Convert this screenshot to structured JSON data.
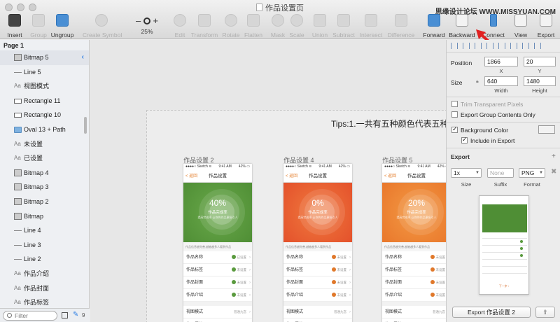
{
  "window": {
    "title": "作品设置页",
    "watermark": "思缘设计论坛 WWW.MISSYUAN.COM"
  },
  "toolbar": {
    "insert": "Insert",
    "group": "Group",
    "ungroup": "Ungroup",
    "create_symbol": "Create Symbol",
    "zoom_minus": "–",
    "zoom_plus": "+",
    "zoom_level": "25%",
    "edit": "Edit",
    "transform": "Transform",
    "rotate": "Rotate",
    "flatten": "Flatten",
    "mask": "Mask",
    "scale": "Scale",
    "union": "Union",
    "subtract": "Subtract",
    "intersect": "Intersect",
    "difference": "Difference",
    "forward": "Forward",
    "backward": "Backward",
    "connect": "Connect",
    "view": "View",
    "export": "Export"
  },
  "sidebar": {
    "page_label": "Page 1",
    "layers": [
      {
        "name": "Bitmap 5",
        "kind": "bitmap",
        "selected": true
      },
      {
        "name": "Line 5",
        "kind": "line"
      },
      {
        "name": "视图模式",
        "kind": "text"
      },
      {
        "name": "Rectangle 11",
        "kind": "rect"
      },
      {
        "name": "Rectangle 10",
        "kind": "rect"
      },
      {
        "name": "Oval 13 + Path",
        "kind": "folder"
      },
      {
        "name": "未设置",
        "kind": "text"
      },
      {
        "name": "已设置",
        "kind": "text"
      },
      {
        "name": "Bitmap 4",
        "kind": "bitmap"
      },
      {
        "name": "Bitmap 3",
        "kind": "bitmap"
      },
      {
        "name": "Bitmap 2",
        "kind": "bitmap"
      },
      {
        "name": "Bitmap",
        "kind": "bitmap"
      },
      {
        "name": "Line 4",
        "kind": "line"
      },
      {
        "name": "Line 3",
        "kind": "line"
      },
      {
        "name": "Line 2",
        "kind": "line"
      },
      {
        "name": "作品介绍",
        "kind": "text"
      },
      {
        "name": "作品封面",
        "kind": "text"
      },
      {
        "name": "作品标签",
        "kind": "text"
      }
    ],
    "text_glyph": "Aa",
    "filter_placeholder": "Filter",
    "count": "9"
  },
  "canvas": {
    "tips": "Tips:1.一共有五种颜色代表五种",
    "phones": [
      {
        "label": "作品设置 2",
        "hero_color": "#4f8e35",
        "hero_color2": "#69a84a",
        "percent": "40%",
        "dot_color": "#5a9a3e"
      },
      {
        "label": "作品设置 4",
        "hero_color": "#e4512b",
        "hero_color2": "#ef7a3e",
        "percent": "0%",
        "dot_color": "#e0782a"
      },
      {
        "label": "作品设置 5",
        "hero_color": "#e9772b",
        "hero_color2": "#f39a45",
        "percent": "20%",
        "dot_color": "#e0782a"
      }
    ],
    "phone_common": {
      "carrier": "●●●●○ Sketch ≋",
      "time": "9:41 AM",
      "battery": "42% ▭",
      "back": "< 返回",
      "nav_title": "作品设置",
      "hero_sub": "作品完成率",
      "hero_tiny": "提高完成率 让你的作品更吸引人",
      "note": "作品信息越完善,越被越多人看到作品",
      "rows": [
        "作品名称",
        "作品标签",
        "作品封面",
        "作品介绍"
      ],
      "view_mode": "视图模式",
      "view_mode_value": "普通九宫",
      "extra_row": "作品属性",
      "status_set": "已设置",
      "status_unset": "未设置",
      "chevron": "›"
    }
  },
  "inspector": {
    "position_label": "Position",
    "x": "1866",
    "y": "20",
    "x_label": "X",
    "y_label": "Y",
    "size_label": "Size",
    "width": "640",
    "height": "1480",
    "width_label": "Width",
    "height_label": "Height",
    "trim": "Trim Transparent Pixels",
    "export_group": "Export Group Contents Only",
    "bg_color": "Background Color",
    "include_export": "Include in Export",
    "export_header": "Export",
    "plus": "+",
    "scale": "1x",
    "suffix_placeholder": "None",
    "format": "PNG",
    "scale_label": "Size",
    "suffix_label": "Suffix",
    "format_label": "Format",
    "remove": "✖",
    "preview_link": "下一步 ›",
    "export_button": "Export 作品设置 2",
    "share": "⇪"
  }
}
